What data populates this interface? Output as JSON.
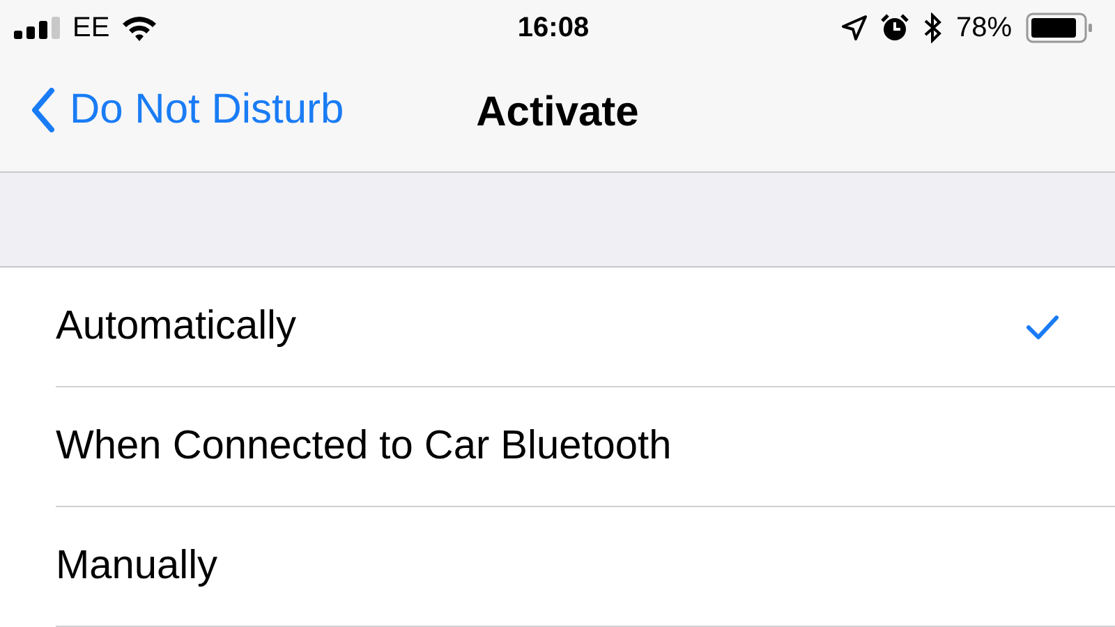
{
  "status_bar": {
    "carrier": "EE",
    "time": "16:08",
    "battery": "78%"
  },
  "nav_bar": {
    "back": "Do Not Disturb",
    "title": "Activate"
  },
  "options": [
    {
      "label": "Automatically",
      "selected": true
    },
    {
      "label": "When Connected to Car Bluetooth",
      "selected": false
    },
    {
      "label": "Manually",
      "selected": false
    }
  ]
}
